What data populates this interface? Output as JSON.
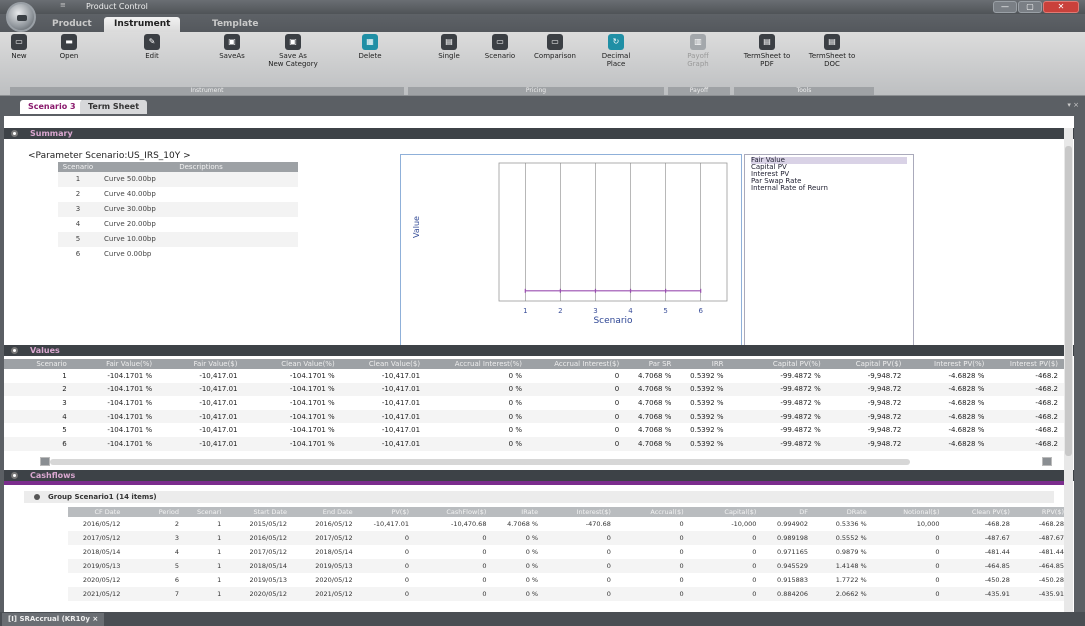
{
  "window": {
    "quick_access": "≡",
    "title": "Product Control",
    "min_label": "—",
    "max_label": "▢",
    "close_label": "✕"
  },
  "ribbon": {
    "tabs": [
      "Product",
      "Instrument",
      "Template"
    ],
    "active_tab": "Instrument",
    "buttons": [
      "New",
      "Open",
      "Edit",
      "SaveAs",
      "Save As\nNew Category",
      "Delete",
      "Single",
      "Scenario",
      "Comparison",
      "Decimal\nPlace",
      "Payoff\nGraph",
      "TermSheet to\nPDF",
      "TermSheet to\nDOC"
    ],
    "groups": [
      "Instrument",
      "Pricing",
      "Payoff",
      "Tools"
    ]
  },
  "doc_tabs": [
    "Scenario 3",
    "Term Sheet"
  ],
  "pin_label": "▾ ×",
  "summary": {
    "header": "Summary",
    "parameter_label": "<Parameter Scenario:US_IRS_10Y >",
    "columns": [
      "Scenario",
      "Descriptions"
    ],
    "rows": [
      {
        "n": "1",
        "d": "Curve 50.00bp"
      },
      {
        "n": "2",
        "d": "Curve 40.00bp"
      },
      {
        "n": "3",
        "d": "Curve 30.00bp"
      },
      {
        "n": "4",
        "d": "Curve 20.00bp"
      },
      {
        "n": "5",
        "d": "Curve 10.00bp"
      },
      {
        "n": "6",
        "d": "Curve 0.00bp"
      }
    ],
    "listbox": [
      "Fair Value",
      "Capital PV",
      "Interest PV",
      "Par Swap Rate",
      "Internal Rate of Reurn"
    ]
  },
  "chart_data": {
    "type": "line",
    "xlabel": "Scenario",
    "ylabel": "Value",
    "x": [
      1,
      2,
      3,
      4,
      5,
      6
    ],
    "series": [
      {
        "name": "Fair Value",
        "values": [
          -10417.01,
          -10417.01,
          -10417.01,
          -10417.01,
          -10417.01,
          -10417.01
        ]
      }
    ],
    "color": "#9a4fb0",
    "grid": "vertical"
  },
  "values": {
    "header": "Values",
    "columns": [
      "Scenario",
      "Fair Value(%)",
      "Fair Value($)",
      "Clean Value(%)",
      "Clean Value($)",
      "Accrual Interest(%)",
      "Accrual Interest($)",
      "Par SR",
      "IRR",
      "Capital PV(%)",
      "Capital PV($)",
      "Interest PV(%)",
      "Interest PV($)"
    ],
    "rows": [
      [
        "1",
        "-104.1701 %",
        "-10,417.01",
        "-104.1701 %",
        "-10,417.01",
        "0 %",
        "0",
        "4.7068 %",
        "0.5392 %",
        "-99.4872 %",
        "-9,948.72",
        "-4.6828 %",
        "-468.2"
      ],
      [
        "2",
        "-104.1701 %",
        "-10,417.01",
        "-104.1701 %",
        "-10,417.01",
        "0 %",
        "0",
        "4.7068 %",
        "0.5392 %",
        "-99.4872 %",
        "-9,948.72",
        "-4.6828 %",
        "-468.2"
      ],
      [
        "3",
        "-104.1701 %",
        "-10,417.01",
        "-104.1701 %",
        "-10,417.01",
        "0 %",
        "0",
        "4.7068 %",
        "0.5392 %",
        "-99.4872 %",
        "-9,948.72",
        "-4.6828 %",
        "-468.2"
      ],
      [
        "4",
        "-104.1701 %",
        "-10,417.01",
        "-104.1701 %",
        "-10,417.01",
        "0 %",
        "0",
        "4.7068 %",
        "0.5392 %",
        "-99.4872 %",
        "-9,948.72",
        "-4.6828 %",
        "-468.2"
      ],
      [
        "5",
        "-104.1701 %",
        "-10,417.01",
        "-104.1701 %",
        "-10,417.01",
        "0 %",
        "0",
        "4.7068 %",
        "0.5392 %",
        "-99.4872 %",
        "-9,948.72",
        "-4.6828 %",
        "-468.2"
      ],
      [
        "6",
        "-104.1701 %",
        "-10,417.01",
        "-104.1701 %",
        "-10,417.01",
        "0 %",
        "0",
        "4.7068 %",
        "0.5392 %",
        "-99.4872 %",
        "-9,948.72",
        "-4.6828 %",
        "-468.2"
      ]
    ]
  },
  "cashflows": {
    "header": "Cashflows",
    "group_label": "Group Scenario1 (14 items)",
    "columns": [
      "CF Date",
      "Period",
      "Scenari",
      "Start Date",
      "End Date",
      "PV($)",
      "CashFlow($)",
      "IRate",
      "Interest($)",
      "Accrual($)",
      "Capital($)",
      "DF",
      "DRate",
      "Notional($)",
      "Clean PV($)",
      "RPV($)"
    ],
    "rows": [
      [
        "2016/05/12",
        "2",
        "1",
        "2015/05/12",
        "2016/05/12",
        "-10,417.01",
        "-10,470.68",
        "4.7068 %",
        "-470.68",
        "0",
        "-10,000",
        "0.994902",
        "0.5336 %",
        "10,000",
        "-468.28",
        "-468.28"
      ],
      [
        "2017/05/12",
        "3",
        "1",
        "2016/05/12",
        "2017/05/12",
        "0",
        "0",
        "0 %",
        "0",
        "0",
        "0",
        "0.989198",
        "0.5552 %",
        "0",
        "-487.67",
        "-487.67"
      ],
      [
        "2018/05/14",
        "4",
        "1",
        "2017/05/12",
        "2018/05/14",
        "0",
        "0",
        "0 %",
        "0",
        "0",
        "0",
        "0.971165",
        "0.9879 %",
        "0",
        "-481.44",
        "-481.44"
      ],
      [
        "2019/05/13",
        "5",
        "1",
        "2018/05/14",
        "2019/05/13",
        "0",
        "0",
        "0 %",
        "0",
        "0",
        "0",
        "0.945529",
        "1.4148 %",
        "0",
        "-464.85",
        "-464.85"
      ],
      [
        "2020/05/12",
        "6",
        "1",
        "2019/05/13",
        "2020/05/12",
        "0",
        "0",
        "0 %",
        "0",
        "0",
        "0",
        "0.915883",
        "1.7722 %",
        "0",
        "-450.28",
        "-450.28"
      ],
      [
        "2021/05/12",
        "7",
        "1",
        "2020/05/12",
        "2021/05/12",
        "0",
        "0",
        "0 %",
        "0",
        "0",
        "0",
        "0.884206",
        "2.0662 %",
        "0",
        "-435.91",
        "-435.91"
      ]
    ]
  },
  "bottom_tab": "[I] SRAccrual (KR10y ×"
}
